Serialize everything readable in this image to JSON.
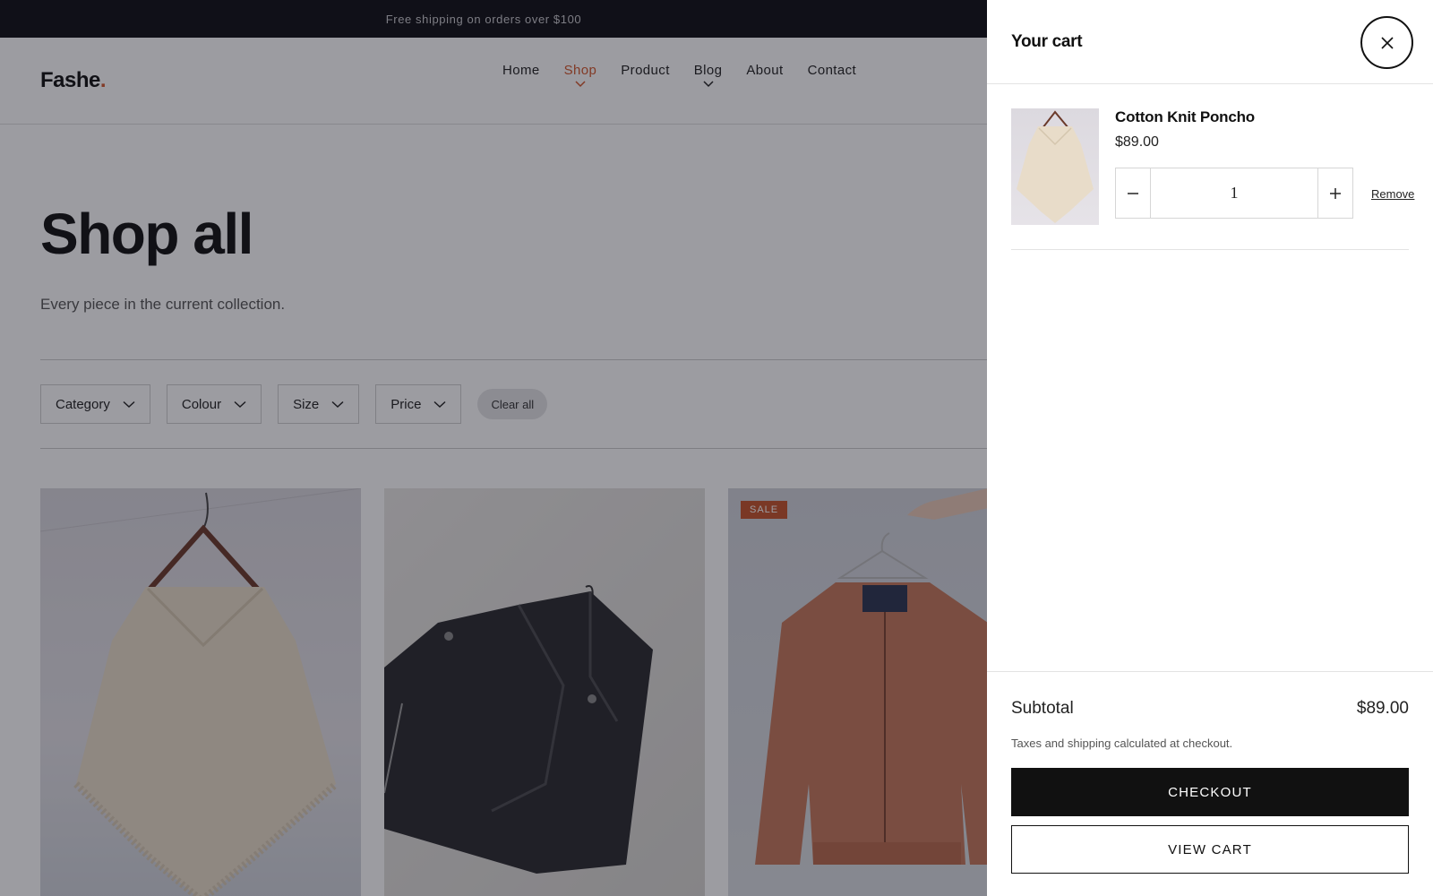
{
  "announcement": "Free shipping on orders over $100",
  "brand": {
    "name": "Fashe",
    "dot": ".",
    "accent": "#d2572b"
  },
  "nav": [
    {
      "label": "Home"
    },
    {
      "label": "Shop"
    },
    {
      "label": "Product"
    },
    {
      "label": "Blog"
    },
    {
      "label": "About"
    },
    {
      "label": "Contact"
    }
  ],
  "hero": {
    "title": "Shop all",
    "subtitle": "Every piece in the current collection."
  },
  "filters": {
    "category": "Category",
    "colour": "Colour",
    "size": "Size",
    "price": "Price",
    "clear": "Clear all"
  },
  "products": [
    {
      "image": "cream-knit-poncho"
    },
    {
      "image": "black-leather-jacket"
    },
    {
      "image": "rust-bomber-jacket",
      "badge": "SALE"
    }
  ],
  "cart": {
    "title": "Your cart",
    "item": {
      "name": "Cotton Knit Poncho",
      "price": "$89.00",
      "quantity": "1",
      "remove": "Remove"
    },
    "subtotal_label": "Subtotal",
    "subtotal_value": "$89.00",
    "tax_note": "Taxes and shipping calculated at checkout.",
    "checkout_label": "CHECKOUT",
    "view_cart_label": "VIEW CART"
  }
}
